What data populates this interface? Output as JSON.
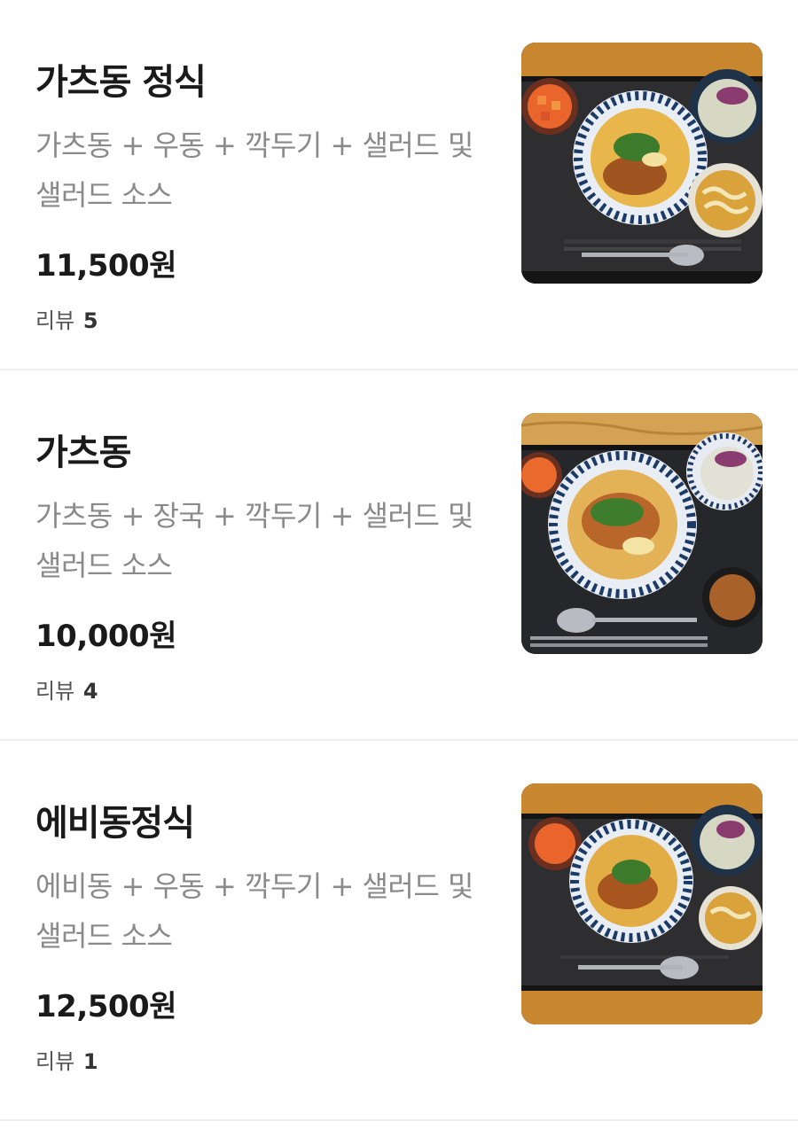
{
  "menu": {
    "items": [
      {
        "name": "가츠동 정식",
        "description": "가츠동 + 우동 + 깍두기 + 샐러드 및 샐러드 소스",
        "price": "11,500원",
        "review_label": "리뷰",
        "review_count": "5"
      },
      {
        "name": "가츠동",
        "description": "가츠동 + 장국 + 깍두기 + 샐러드 및 샐러드 소스",
        "price": "10,000원",
        "review_label": "리뷰",
        "review_count": "4"
      },
      {
        "name": "에비동정식",
        "description": "에비동 + 우동 + 깍두기 + 샐러드 및 샐러드 소스",
        "price": "12,500원",
        "review_label": "리뷰",
        "review_count": "1"
      }
    ]
  }
}
